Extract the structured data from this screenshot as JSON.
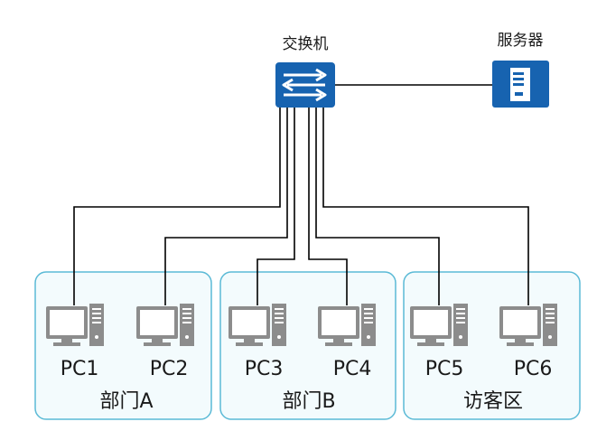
{
  "switch": {
    "label": "交换机",
    "icon": "switch-icon"
  },
  "server": {
    "label": "服务器",
    "icon": "server-icon"
  },
  "groups": [
    {
      "label": "部门A",
      "pcs": [
        "PC1",
        "PC2"
      ]
    },
    {
      "label": "部门B",
      "pcs": [
        "PC3",
        "PC4"
      ]
    },
    {
      "label": "访客区",
      "pcs": [
        "PC5",
        "PC6"
      ]
    }
  ],
  "colors": {
    "switch_fill": "#1763b0",
    "server_fill": "#1763b0",
    "group_border": "#5bbad6",
    "group_fill": "#f3fbfd",
    "pc_gray": "#8c8c8c",
    "line": "#000000"
  }
}
